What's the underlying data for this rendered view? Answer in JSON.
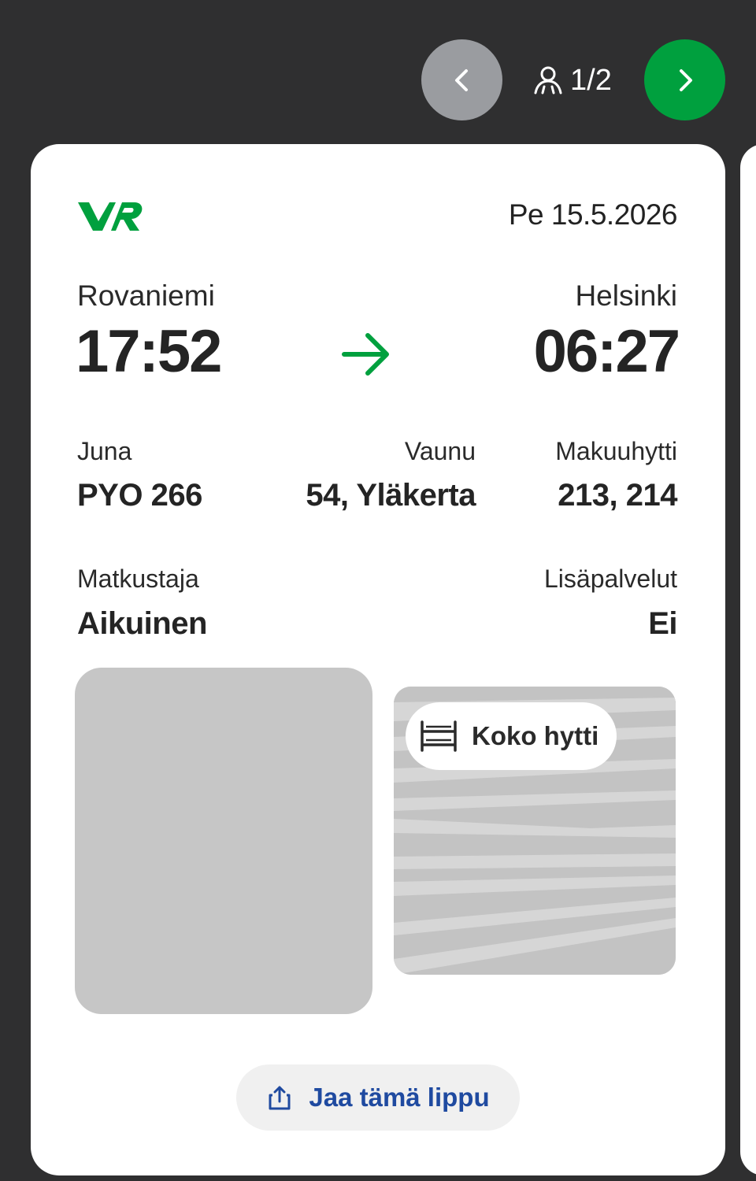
{
  "navigation": {
    "prev_icon": "chevron-left-icon",
    "next_icon": "chevron-right-icon",
    "passenger_icon": "person-icon",
    "passenger_counter": "1/2",
    "colors": {
      "prev_bg": "#9a9ca0",
      "next_bg": "#00a03e"
    }
  },
  "ticket": {
    "brand_logo_text": "VR",
    "brand_color": "#00a03e",
    "date": "Pe 15.5.2026",
    "departure": {
      "city": "Rovaniemi",
      "time": "17:52"
    },
    "arrival": {
      "city": "Helsinki",
      "time": "06:27"
    },
    "route_icon": "arrow-right-icon",
    "train": {
      "label": "Juna",
      "value": "PYO 266"
    },
    "carriage": {
      "label": "Vaunu",
      "value": "54, Yläkerta"
    },
    "cabin": {
      "label": "Makuuhytti",
      "value": "213, 214"
    },
    "passenger": {
      "label": "Matkustaja",
      "value": "Aikuinen"
    },
    "extras": {
      "label": "Lisäpalvelut",
      "value": "Ei"
    },
    "cabin_badge": {
      "icon": "bunk-bed-icon",
      "label": "Koko hytti"
    },
    "share_button": {
      "icon": "share-icon",
      "label": "Jaa tämä lippu",
      "color": "#1f4aa0"
    }
  }
}
